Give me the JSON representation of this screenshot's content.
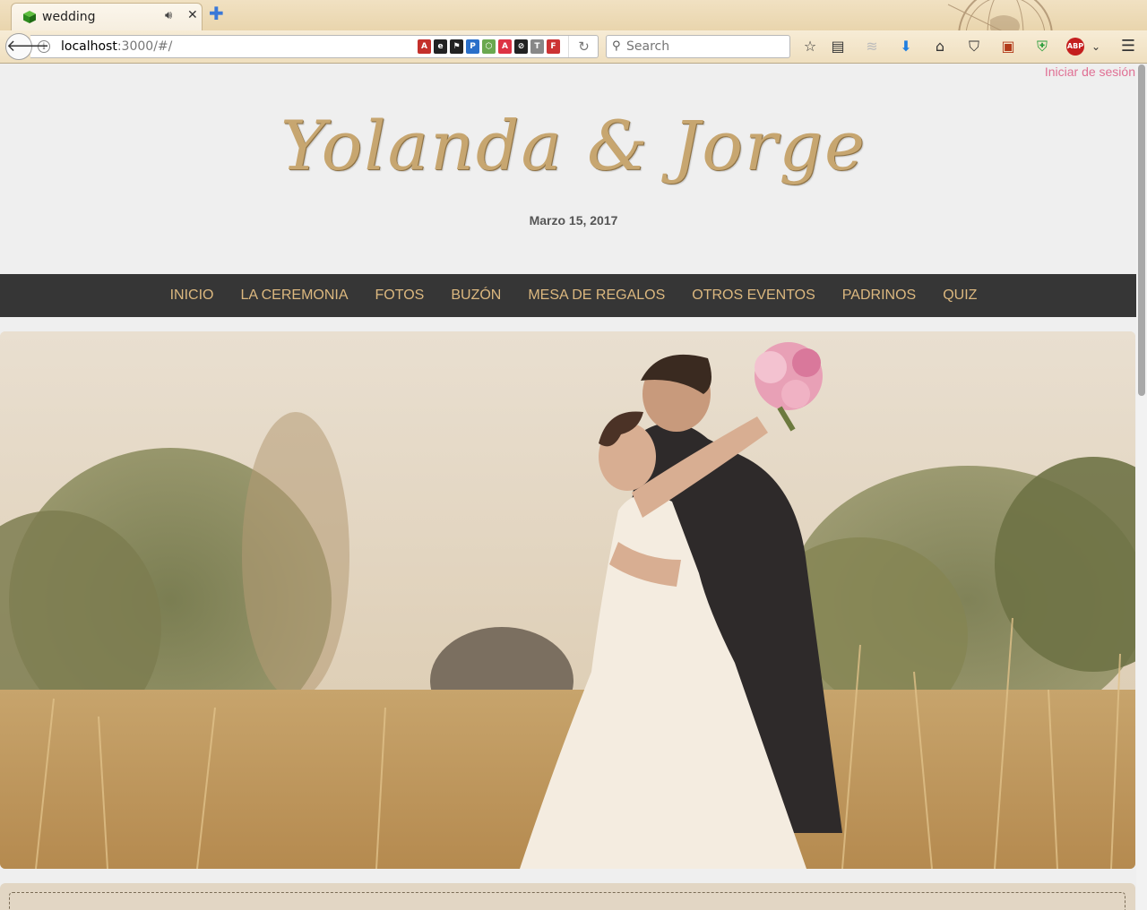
{
  "browser": {
    "tab": {
      "title": "wedding"
    },
    "url": {
      "host": "localhost",
      "rest": ":3000/#/"
    },
    "search": {
      "placeholder": "Search"
    },
    "extensions": [
      {
        "name": "angular-icon",
        "color": "#c4302b",
        "glyph": "A"
      },
      {
        "name": "ember-icon",
        "color": "#222222",
        "glyph": "e"
      },
      {
        "name": "flag-icon",
        "color": "#222222",
        "glyph": "⚑"
      },
      {
        "name": "p-icon",
        "color": "#2a6fc9",
        "glyph": "P"
      },
      {
        "name": "node-icon",
        "color": "#6aa84f",
        "glyph": "⬡"
      },
      {
        "name": "angular2-icon",
        "color": "#dd3344",
        "glyph": "A"
      },
      {
        "name": "compass-icon",
        "color": "#222222",
        "glyph": "⊘"
      },
      {
        "name": "tinymce-icon",
        "color": "#888888",
        "glyph": "T"
      },
      {
        "name": "firebug-icon",
        "color": "#cc3333",
        "glyph": "F"
      }
    ]
  },
  "page": {
    "login_link": "Iniciar de sesión",
    "couple_names": "Yolanda & Jorge",
    "date": "Marzo 15, 2017",
    "nav": [
      "INICIO",
      "LA CEREMONIA",
      "FOTOS",
      "BUZÓN",
      "MESA DE REGALOS",
      "OTROS EVENTOS",
      "PADRINOS",
      "QUIZ"
    ]
  },
  "colors": {
    "accent_gold": "#c7a670",
    "nav_bar": "#363636",
    "nav_text": "#dcb87f",
    "login_pink": "#e07094"
  }
}
